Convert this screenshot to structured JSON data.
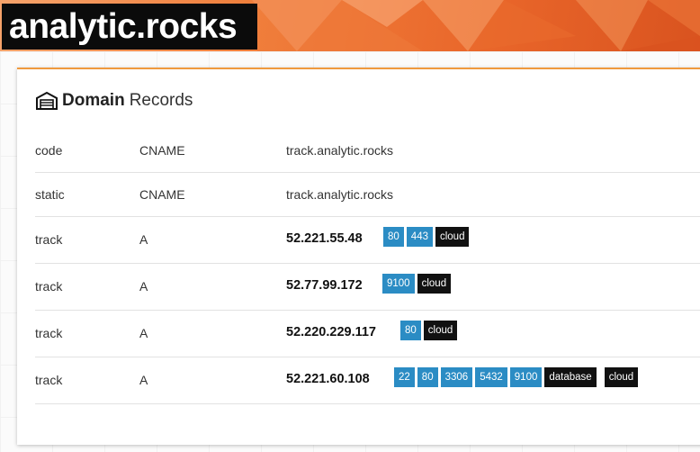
{
  "site": {
    "title": "analytic.rocks"
  },
  "card": {
    "title_bold": "Domain",
    "title_light": "Records",
    "icon": "warehouse-icon"
  },
  "records": [
    {
      "name": "code",
      "type": "CNAME",
      "value": "track.analytic.rocks"
    },
    {
      "name": "static",
      "type": "CNAME",
      "value": "track.analytic.rocks"
    },
    {
      "name": "track",
      "type": "A",
      "value": "52.221.55.48",
      "ports": [
        "80",
        "443"
      ],
      "labels": [
        "cloud"
      ]
    },
    {
      "name": "track",
      "type": "A",
      "value": "52.77.99.172",
      "ports": [
        "9100"
      ],
      "labels": [
        "cloud"
      ]
    },
    {
      "name": "track",
      "type": "A",
      "value": "52.220.229.117",
      "ports": [
        "80"
      ],
      "labels": [
        "cloud"
      ]
    },
    {
      "name": "track",
      "type": "A",
      "value": "52.221.60.108",
      "ports": [
        "22",
        "80",
        "3306",
        "5432",
        "9100"
      ],
      "labels": [
        "database",
        "cloud"
      ]
    }
  ],
  "colors": {
    "accent": "#f09a3e",
    "port_tag": "#2b8cc4",
    "label_tag": "#111111"
  }
}
